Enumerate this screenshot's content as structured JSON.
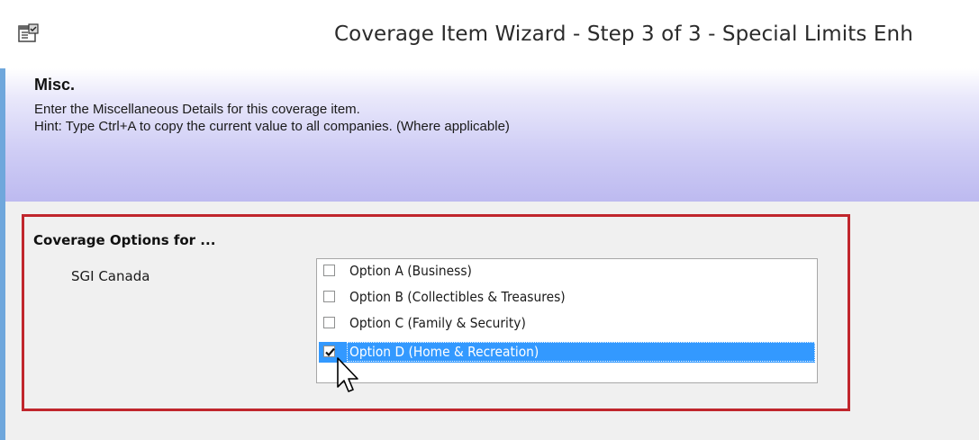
{
  "window": {
    "title": "Coverage Item Wizard - Step 3 of 3 - Special Limits Enh",
    "icon": "properties-icon"
  },
  "header": {
    "title": "Misc.",
    "description": "Enter the Miscellaneous Details for this coverage item.",
    "hint": "Hint: Type Ctrl+A to copy the current value to all companies. (Where applicable)"
  },
  "coverage_options": {
    "group_title": "Coverage Options for ...",
    "company": "SGI Canada",
    "options": [
      {
        "label": "Option A (Business)",
        "checked": false,
        "selected": false
      },
      {
        "label": "Option B (Collectibles & Treasures)",
        "checked": false,
        "selected": false
      },
      {
        "label": "Option C (Family & Security)",
        "checked": false,
        "selected": false
      },
      {
        "label": "Option D (Home & Recreation)",
        "checked": true,
        "selected": true
      }
    ]
  },
  "colors": {
    "highlight_border": "#c0262d",
    "selection": "#3399ff",
    "header_gradient_end": "#bdbaf0"
  }
}
